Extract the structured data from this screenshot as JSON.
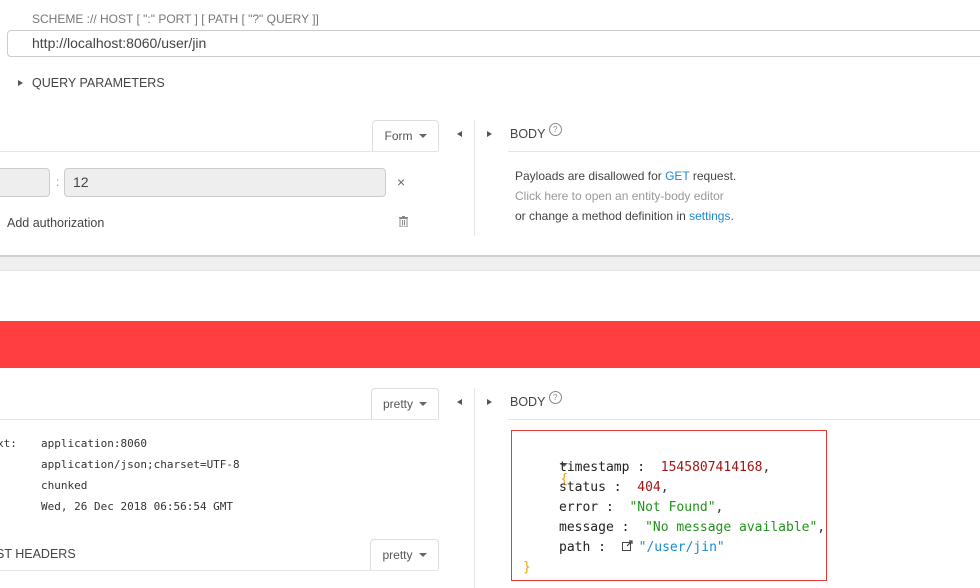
{
  "request": {
    "scheme_hint": "SCHEME :// HOST [ \":\" PORT ] [ PATH [ \"?\" QUERY ]]",
    "url": "http://localhost:8060/user/jin",
    "query_parameters_label": "QUERY PARAMETERS",
    "headers_mode": "Form",
    "header_row": {
      "name": "",
      "separator": ":",
      "value": "12"
    },
    "add_authorization_label": "Add authorization",
    "body": {
      "label": "BODY",
      "help": "?",
      "line1_prefix": "Payloads are disallowed for ",
      "line1_method": "GET",
      "line1_suffix": " request.",
      "line2": "Click here to open an entity-body editor",
      "line3_prefix": "or change a method definition in ",
      "line3_link": "settings",
      "line3_suffix": "."
    }
  },
  "status_bar": {
    "color": "#ff3f3f"
  },
  "response": {
    "headers_mode": "pretty",
    "headers": [
      {
        "name": "xt:",
        "value": "application:8060"
      },
      {
        "name": "",
        "value": "application/json;charset=UTF-8"
      },
      {
        "name": "",
        "value": "chunked"
      },
      {
        "name": "",
        "value": "Wed, 26 Dec 2018 06:56:54 GMT"
      }
    ],
    "request_headers_label": "ST HEADERS",
    "request_headers_mode": "pretty",
    "body_label": "BODY",
    "body_help": "?",
    "json": {
      "open": "{",
      "close": "}",
      "fields": [
        {
          "key": "timestamp",
          "sep": " :  ",
          "value": "1545807414168",
          "type": "number",
          "trail": ","
        },
        {
          "key": "status",
          "sep": " :  ",
          "value": "404",
          "type": "number",
          "trail": ","
        },
        {
          "key": "error",
          "sep": " :  ",
          "value": "\"Not Found\"",
          "type": "string",
          "trail": ","
        },
        {
          "key": "message",
          "sep": " :  ",
          "value": "\"No message available\"",
          "type": "string",
          "trail": ","
        },
        {
          "key": "path",
          "sep": " :  ",
          "value": "\"/user/jin\"",
          "type": "link",
          "trail": ""
        }
      ]
    }
  }
}
